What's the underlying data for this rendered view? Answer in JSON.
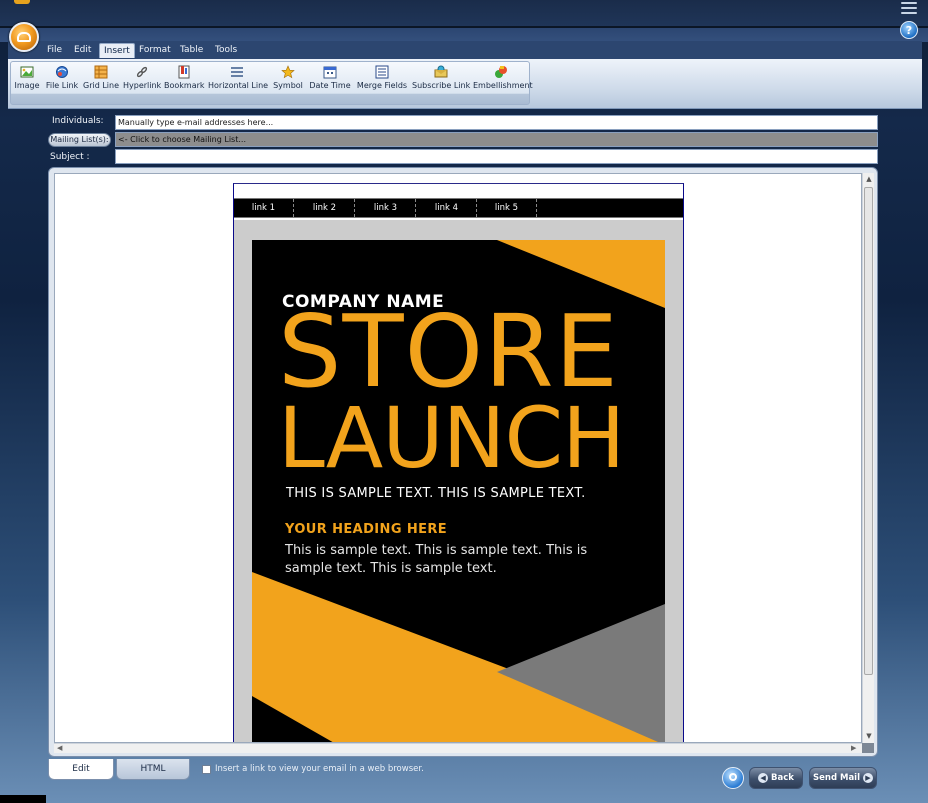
{
  "menu": {
    "items": [
      {
        "label": "File",
        "active": false
      },
      {
        "label": "Edit",
        "active": false
      },
      {
        "label": "Insert",
        "active": true
      },
      {
        "label": "Format",
        "active": false
      },
      {
        "label": "Table",
        "active": false
      },
      {
        "label": "Tools",
        "active": false
      }
    ]
  },
  "ribbon": {
    "buttons": [
      {
        "label": "Image",
        "icon": "image-icon"
      },
      {
        "label": "File Link",
        "icon": "file-link-icon"
      },
      {
        "label": "Grid Line",
        "icon": "grid-line-icon"
      },
      {
        "label": "Hyperlink",
        "icon": "hyperlink-icon"
      },
      {
        "label": "Bookmark",
        "icon": "bookmark-icon"
      },
      {
        "label": "Horizontal Line",
        "icon": "horizontal-line-icon"
      },
      {
        "label": "Symbol",
        "icon": "symbol-icon"
      },
      {
        "label": "Date Time",
        "icon": "date-time-icon"
      },
      {
        "label": "Merge Fields",
        "icon": "merge-fields-icon"
      },
      {
        "label": "Subscribe Link",
        "icon": "subscribe-link-icon"
      },
      {
        "label": "Embellishment",
        "icon": "embellishment-icon"
      }
    ]
  },
  "fields": {
    "individuals_label": "Individuals:",
    "individuals_value": "Manually type e-mail addresses here...",
    "mailing_button": "Mailing List(s):",
    "mailing_value": "<- Click to choose Mailing List...",
    "subject_label": "Subject :",
    "subject_value": ""
  },
  "email": {
    "nav_links": [
      "link 1",
      "link 2",
      "link 3",
      "link 4",
      "link 5"
    ],
    "company": "COMPANY NAME",
    "title_line1": "STORE",
    "title_line2": "LAUNCH",
    "tagline": "THIS IS SAMPLE TEXT. THIS IS SAMPLE TEXT.",
    "heading": "YOUR HEADING HERE",
    "body": "This is sample text. This is sample text. This is sample text. This is sample text."
  },
  "colors": {
    "accent_orange": "#f2a31c",
    "hero_black": "#000000",
    "hero_gray": "#7a7a7a"
  },
  "bottom": {
    "tab_edit": "Edit",
    "tab_html": "HTML",
    "checkbox_label": "Insert a link to view your email in a web browser.",
    "checkbox_checked": false,
    "back_label": "Back",
    "send_label": "Send Mail"
  },
  "help": {
    "glyph": "?"
  }
}
